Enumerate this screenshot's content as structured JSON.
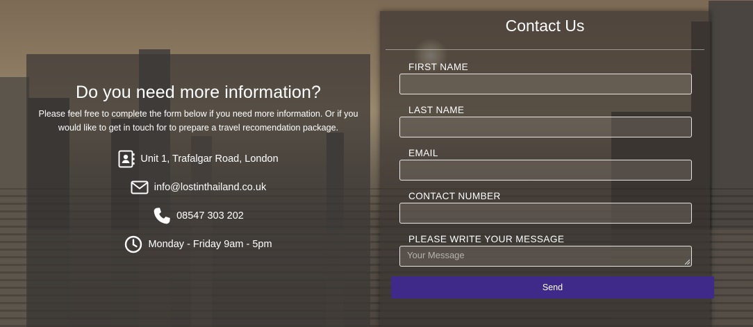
{
  "info": {
    "title": "Do you need more information?",
    "lead": "Please feel free to complete the form below if you need more information. Or if you would like to get in touch for to prepare a travel recomendation package.",
    "address": "Unit 1, Trafalgar Road, London",
    "email": "info@lostinthailand.co.uk",
    "phone": "08547 303 202",
    "hours": "Monday - Friday 9am - 5pm"
  },
  "form": {
    "title": "Contact Us",
    "first_name_label": "FIRST NAME",
    "last_name_label": "LAST NAME",
    "email_label": "EMAIL",
    "contact_number_label": "CONTACT NUMBER",
    "message_label": "PLEASE WRITE YOUR MESSAGE",
    "message_placeholder": "Your Message",
    "send_label": "Send"
  },
  "colors": {
    "send_button": "#3f2a8a"
  },
  "icons": [
    "address-book-icon",
    "envelope-icon",
    "phone-icon",
    "clock-icon"
  ]
}
